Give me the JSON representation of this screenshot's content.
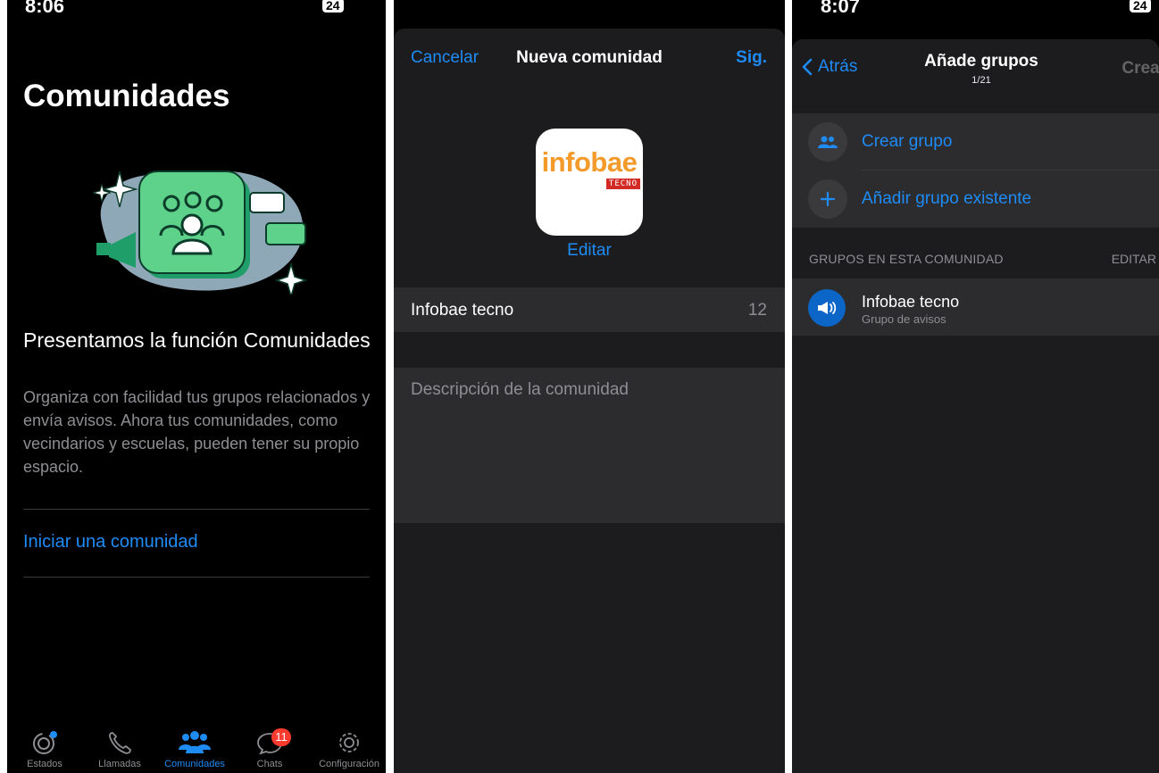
{
  "panel1": {
    "status_time": "8:06",
    "status_battery": "24",
    "title": "Comunidades",
    "heading": "Presentamos la función Comunidades",
    "body": "Organiza con facilidad tus grupos relacionados y envía avisos. Ahora tus comunidades, como vecindarios y escuelas, pueden tener su propio espacio.",
    "start_link": "Iniciar una comunidad",
    "tabs": [
      {
        "label": "Estados",
        "icon": "status-icon"
      },
      {
        "label": "Llamadas",
        "icon": "phone-icon"
      },
      {
        "label": "Comunidades",
        "icon": "communities-icon"
      },
      {
        "label": "Chats",
        "icon": "chat-bubble-icon"
      },
      {
        "label": "Configuración",
        "icon": "gear-icon"
      }
    ],
    "active_tab": "Comunidades",
    "chats_badge": "11"
  },
  "panel2": {
    "cancel": "Cancelar",
    "title": "Nueva comunidad",
    "next": "Sig.",
    "logo_word": "infobae",
    "logo_sub": "TECNO",
    "edit": "Editar",
    "name_value": "Infobae tecno",
    "name_counter": "12",
    "description_placeholder": "Descripción de la comunidad"
  },
  "panel3": {
    "status_time": "8:07",
    "status_battery": "24",
    "back": "Atrás",
    "title": "Añade grupos",
    "subtitle": "1/21",
    "create": "Crear",
    "create_group": "Crear grupo",
    "add_existing": "Añadir grupo existente",
    "section_header": "GRUPOS EN ESTA COMUNIDAD",
    "section_edit": "EDITAR",
    "group_name": "Infobae tecno",
    "group_sub": "Grupo de avisos"
  },
  "colors": {
    "accent": "#1f8bf5",
    "badge": "#ff3b30",
    "illustration_green": "#5ed18a",
    "illustration_blob": "#8ea8b8"
  }
}
